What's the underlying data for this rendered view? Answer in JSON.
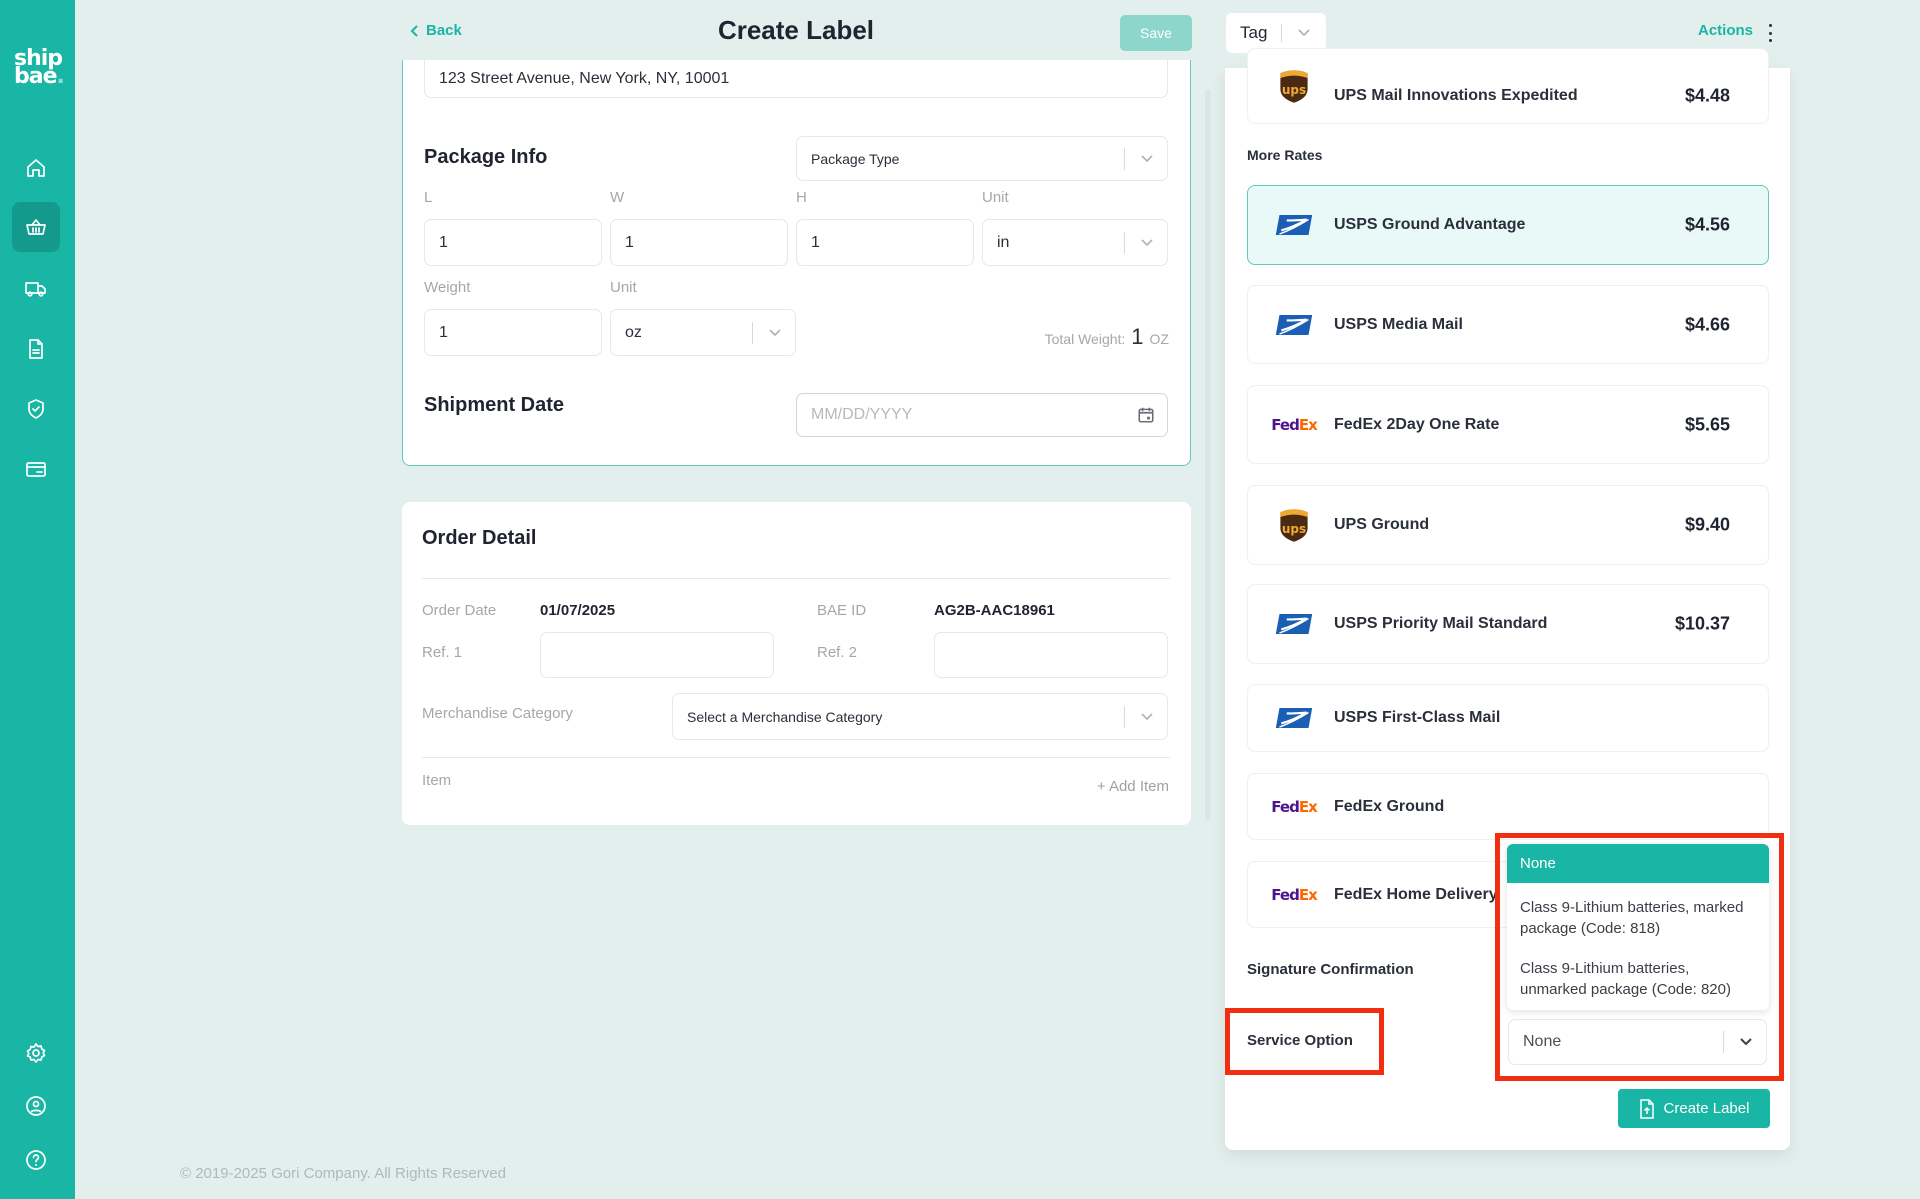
{
  "app": {
    "logo_line1": "ship",
    "logo_line2": "bae",
    "brand_color": "#19b5a5"
  },
  "sidebar": {
    "items": [
      {
        "icon": "home-icon",
        "active": false
      },
      {
        "icon": "basket-icon",
        "active": true
      },
      {
        "icon": "truck-icon",
        "active": false
      },
      {
        "icon": "document-icon",
        "active": false
      },
      {
        "icon": "shield-check-icon",
        "active": false
      },
      {
        "icon": "credit-card-icon",
        "active": false
      }
    ],
    "bottom_items": [
      {
        "icon": "gear-icon"
      },
      {
        "icon": "user-circle-icon"
      },
      {
        "icon": "help-icon"
      }
    ]
  },
  "header": {
    "back_label": "Back",
    "title": "Create Label",
    "save_label": "Save",
    "tag_placeholder": "Tag",
    "actions_label": "Actions"
  },
  "shipping_form": {
    "address_value": "123 Street Avenue, New York, NY, 10001",
    "package_info_title": "Package Info",
    "package_type_placeholder": "Package Type",
    "labels": {
      "l": "L",
      "w": "W",
      "h": "H",
      "unit": "Unit",
      "weight": "Weight",
      "weight_unit": "Unit"
    },
    "length": "1",
    "width": "1",
    "height": "1",
    "dimension_unit": "in",
    "weight": "1",
    "weight_unit": "oz",
    "total_weight_label": "Total Weight:",
    "total_weight_value": "1",
    "total_weight_unit": "OZ",
    "shipment_date_title": "Shipment Date",
    "shipment_date_placeholder": "MM/DD/YYYY"
  },
  "order_detail": {
    "title": "Order Detail",
    "order_date_label": "Order Date",
    "order_date_value": "01/07/2025",
    "bae_id_label": "BAE ID",
    "bae_id_value": "AG2B-AAC18961",
    "ref1_label": "Ref. 1",
    "ref1_value": "",
    "ref2_label": "Ref. 2",
    "ref2_value": "",
    "merchandise_label": "Merchandise Category",
    "merchandise_placeholder": "Select a Merchandise Category",
    "item_label": "Item",
    "add_item_label": "+ Add Item"
  },
  "rates": {
    "top_rate": {
      "carrier": "ups",
      "name": "UPS Mail Innovations Expedited",
      "price": "$4.48"
    },
    "more_rates_label": "More Rates",
    "items": [
      {
        "carrier": "usps",
        "name": "USPS Ground Advantage",
        "price": "$4.56",
        "selected": true
      },
      {
        "carrier": "usps",
        "name": "USPS Media Mail",
        "price": "$4.66",
        "selected": false
      },
      {
        "carrier": "fedex",
        "name": "FedEx 2Day One Rate",
        "price": "$5.65",
        "selected": false
      },
      {
        "carrier": "ups",
        "name": "UPS Ground",
        "price": "$9.40",
        "selected": false
      },
      {
        "carrier": "usps",
        "name": "USPS Priority Mail Standard",
        "price": "$10.37",
        "selected": false
      },
      {
        "carrier": "usps",
        "name": "USPS First-Class Mail",
        "price": "",
        "selected": false
      },
      {
        "carrier": "fedex",
        "name": "FedEx Ground",
        "price": "",
        "selected": false
      },
      {
        "carrier": "fedex",
        "name": "FedEx Home Delivery",
        "price": "",
        "selected": false
      }
    ],
    "signature_label": "Signature Confirmation",
    "service_option_label": "Service Option",
    "service_option_value": "None",
    "service_option_menu": [
      {
        "label": "None",
        "active": true
      },
      {
        "label": "Class 9-Lithium batteries, marked package (Code: 818)",
        "active": false
      },
      {
        "label": "Class 9-Lithium batteries, unmarked package (Code: 820)",
        "active": false
      }
    ],
    "create_label_button": "Create Label"
  },
  "footer": {
    "copyright": "© 2019-2025 Gori Company. All Rights Reserved"
  },
  "fedex_text": {
    "fe": "Fed",
    "ex": "Ex"
  },
  "ups_text": "ups"
}
